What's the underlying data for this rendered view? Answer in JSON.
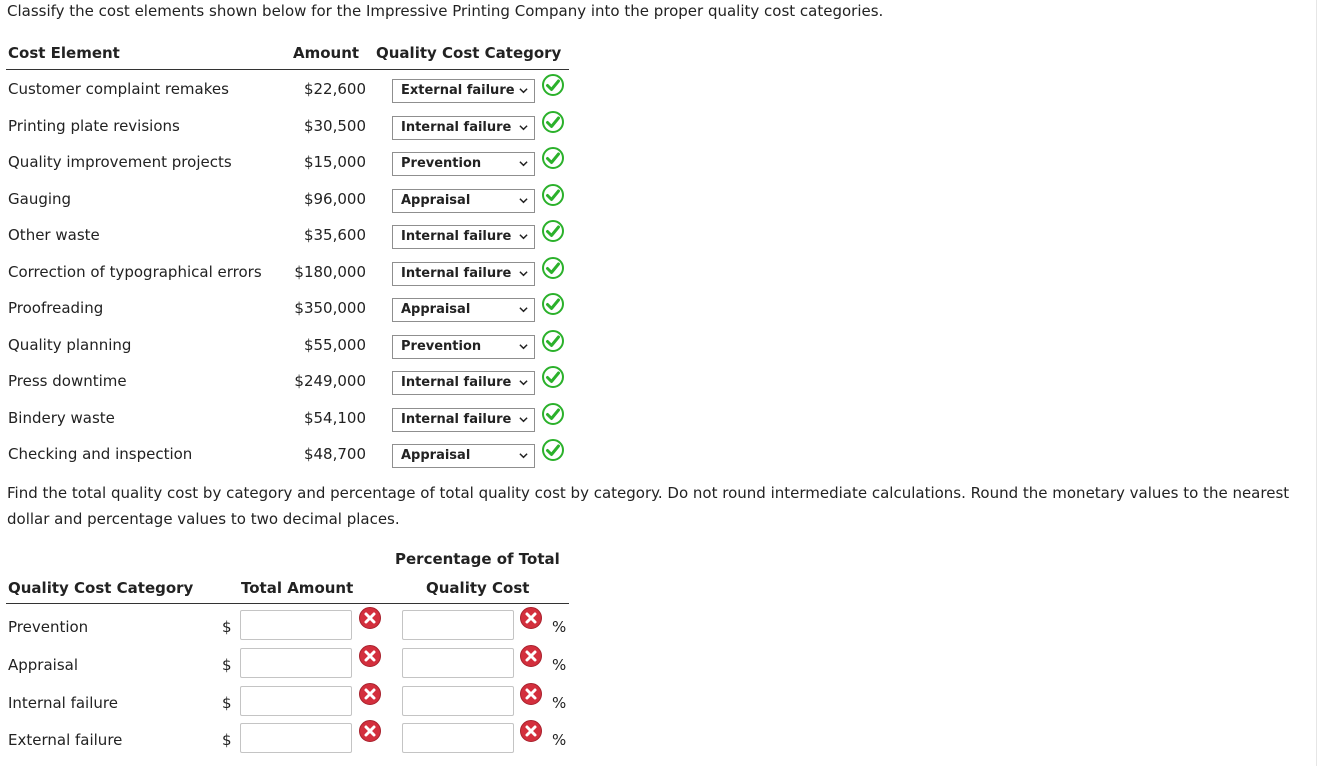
{
  "instruction": "Classify the cost elements shown below for the Impressive Printing Company into the proper quality cost categories.",
  "table1": {
    "headers": {
      "element": "Cost Element",
      "amount": "Amount",
      "category": "Quality Cost Category"
    },
    "rows": [
      {
        "element": "Customer complaint remakes",
        "amount": "$22,600",
        "category": "External failure",
        "correct": true
      },
      {
        "element": "Printing plate revisions",
        "amount": "$30,500",
        "category": "Internal failure",
        "correct": true
      },
      {
        "element": "Quality improvement projects",
        "amount": "$15,000",
        "category": "Prevention",
        "correct": true
      },
      {
        "element": "Gauging",
        "amount": "$96,000",
        "category": "Appraisal",
        "correct": true
      },
      {
        "element": "Other waste",
        "amount": "$35,600",
        "category": "Internal failure",
        "correct": true
      },
      {
        "element": "Correction of typographical errors",
        "amount": "$180,000",
        "category": "Internal failure",
        "correct": true
      },
      {
        "element": "Proofreading",
        "amount": "$350,000",
        "category": "Appraisal",
        "correct": true
      },
      {
        "element": "Quality planning",
        "amount": "$55,000",
        "category": "Prevention",
        "correct": true
      },
      {
        "element": "Press downtime",
        "amount": "$249,000",
        "category": "Internal failure",
        "correct": true
      },
      {
        "element": "Bindery waste",
        "amount": "$54,100",
        "category": "Internal failure",
        "correct": true
      },
      {
        "element": "Checking and inspection",
        "amount": "$48,700",
        "category": "Appraisal",
        "correct": true
      }
    ]
  },
  "paragraph": "Find the total quality cost by category and percentage of total quality cost by category. Do not round intermediate calculations. Round the monetary values to the nearest dollar and percentage values to two decimal places.",
  "table2": {
    "headers": {
      "category": "Quality Cost Category",
      "total": "Total Amount",
      "pct_line1": "Percentage of Total",
      "pct_line2": "Quality Cost"
    },
    "currency_symbol": "$",
    "percent_symbol": "%",
    "rows": [
      {
        "category": "Prevention",
        "amount_value": "",
        "percent_value": "",
        "correct": false
      },
      {
        "category": "Appraisal",
        "amount_value": "",
        "percent_value": "",
        "correct": false
      },
      {
        "category": "Internal failure",
        "amount_value": "",
        "percent_value": "",
        "correct": false
      },
      {
        "category": "External failure",
        "amount_value": "",
        "percent_value": "",
        "correct": false
      }
    ]
  },
  "colors": {
    "correct_green": "#2bb12b",
    "wrong_red": "#d32f3d",
    "border": "#8f8f8f"
  },
  "icons": {
    "correct": "check-circle-icon",
    "wrong": "x-circle-icon",
    "dropdown": "chevron-down-icon"
  }
}
